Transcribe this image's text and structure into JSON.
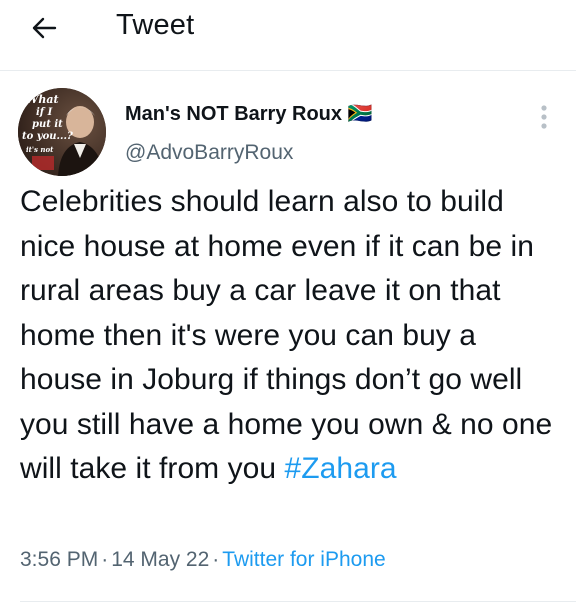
{
  "header": {
    "title": "Tweet",
    "back_icon": "arrow-left-icon"
  },
  "tweet": {
    "display_name": "Man's NOT Barry Roux 🇿🇦",
    "handle": "@AdvoBarryRoux",
    "text_before_hashtag": "Celebrities should learn also to build nice house at home even if it can be in rural areas buy a car leave it on that home then it's were you can buy a house in Joburg if things don’t go well you still have a home you own & no one will take it from you",
    "hashtag": "#Zahara",
    "time": "3:56 PM",
    "date": "14 May 22",
    "source": "Twitter for iPhone",
    "separator": "·",
    "more_icon": "more-vertical-icon"
  },
  "avatar": {
    "text_lines": [
      "What",
      "if I",
      "put it",
      "to you...?"
    ],
    "caption": "it's not"
  },
  "colors": {
    "text": "#0f1419",
    "secondary": "#536471",
    "accent": "#1d9bf0",
    "divider": "#e8ecef"
  }
}
